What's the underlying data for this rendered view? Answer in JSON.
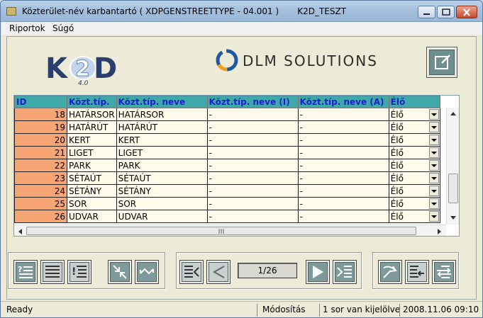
{
  "window": {
    "title": "Közterület-név karbantartó ( XDPGENSTREETTYPE - 04.001 )",
    "env": "K2D_TESZT"
  },
  "menu": [
    "Riportok",
    "Súgó"
  ],
  "logos": {
    "k2d_version": "4.0",
    "dlm": "DLM SOLUTIONS"
  },
  "grid": {
    "columns": [
      "ID",
      "Közt.típ.",
      "Közt.típ. neve",
      "Közt.típ. neve (I)",
      "Közt.típ. neve (A)",
      "Élő"
    ],
    "rows": [
      {
        "id": "18",
        "code": "HATÁRSOR",
        "name": "HATÁRSOR",
        "name_i": "-",
        "name_a": "-",
        "elo": "Élő"
      },
      {
        "id": "19",
        "code": "HATÁRÚT",
        "name": "HATÁRÚT",
        "name_i": "-",
        "name_a": "-",
        "elo": "Élő"
      },
      {
        "id": "20",
        "code": "KERT",
        "name": "KERT",
        "name_i": "-",
        "name_a": "-",
        "elo": "Élő"
      },
      {
        "id": "21",
        "code": "LIGET",
        "name": "LIGET",
        "name_i": "-",
        "name_a": "-",
        "elo": "Élő"
      },
      {
        "id": "22",
        "code": "PARK",
        "name": "PARK",
        "name_i": "-",
        "name_a": "-",
        "elo": "Élő"
      },
      {
        "id": "23",
        "code": "SÉTAÚT",
        "name": "SÉTAÚT",
        "name_i": "-",
        "name_a": "-",
        "elo": "Élő"
      },
      {
        "id": "24",
        "code": "SÉTÁNY",
        "name": "SÉTÁNY",
        "name_i": "-",
        "name_a": "-",
        "elo": "Élő"
      },
      {
        "id": "25",
        "code": "SOR",
        "name": "SOR",
        "name_i": "-",
        "name_a": "-",
        "elo": "Élő"
      },
      {
        "id": "26",
        "code": "UDVAR",
        "name": "UDVAR",
        "name_i": "-",
        "name_a": "-",
        "elo": "Élő"
      }
    ]
  },
  "pager": {
    "text": "1/26"
  },
  "status": {
    "ready": "Ready",
    "mode": "Módosítás",
    "selection": "1 sor van kijelölve",
    "datetime": "2008.11.06 09:10"
  },
  "colors": {
    "header_bg": "#3fa9a9",
    "header_text": "#1f22cc",
    "id_bg": "#f7a574",
    "cell_bg": "#fffaea"
  }
}
